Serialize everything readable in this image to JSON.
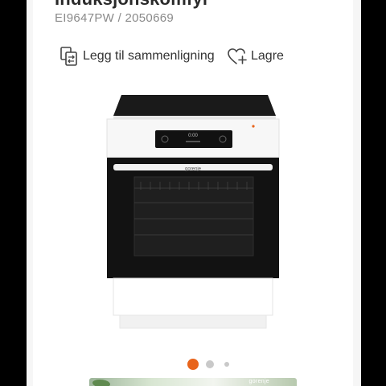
{
  "product": {
    "title": "Induksjonskomfyr",
    "sku": "EI9647PW / 2050669"
  },
  "actions": {
    "compare_label": "Legg til sammenligning",
    "compare_icon": "compare-icon",
    "save_label": "Lagre",
    "save_icon": "heart-plus-icon"
  },
  "image": {
    "brand": "gorenje",
    "display_time": "0:00"
  },
  "carousel": {
    "total_dots": 3,
    "active_index": 0,
    "active_color": "#e8641b",
    "inactive_color": "#c9c9c9"
  },
  "thumbnail": {
    "text": "gorenje"
  }
}
